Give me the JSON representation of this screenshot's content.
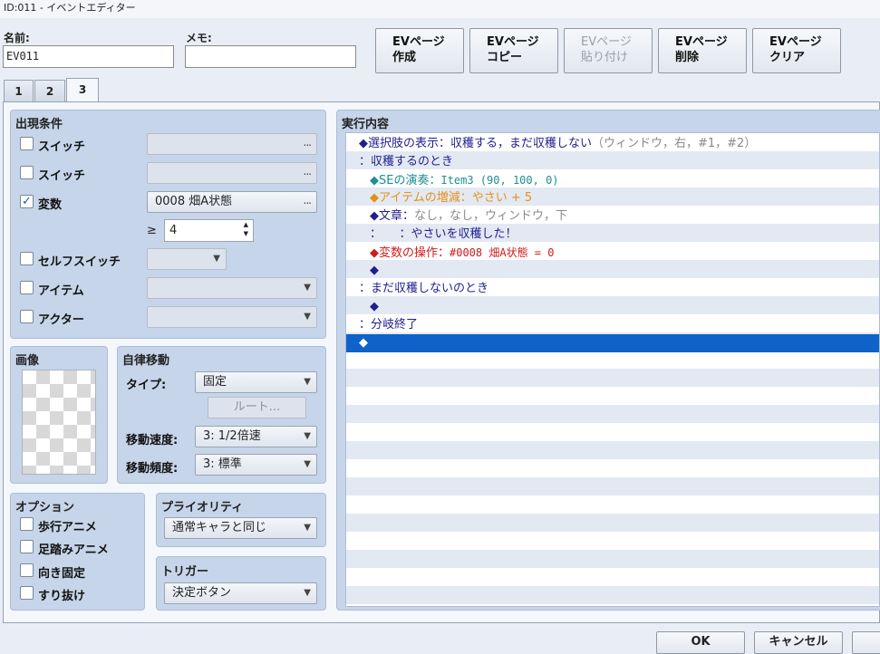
{
  "window": {
    "title": "ID:011 - イベントエディター"
  },
  "name": {
    "label": "名前:",
    "value": "EV011"
  },
  "memo": {
    "label": "メモ:",
    "value": ""
  },
  "page_buttons": [
    {
      "line1": "EVページ",
      "line2": "作成",
      "enabled": true
    },
    {
      "line1": "EVページ",
      "line2": "コピー",
      "enabled": true
    },
    {
      "line1": "EVページ",
      "line2": "貼り付け",
      "enabled": false
    },
    {
      "line1": "EVページ",
      "line2": "削除",
      "enabled": true
    },
    {
      "line1": "EVページ",
      "line2": "クリア",
      "enabled": true
    }
  ],
  "tabs": [
    "1",
    "2",
    "3"
  ],
  "active_tab": "3",
  "conditions": {
    "title": "出現条件",
    "switch1": {
      "label": "スイッチ",
      "checked": false,
      "value": "",
      "button": "..."
    },
    "switch2": {
      "label": "スイッチ",
      "checked": false,
      "value": "",
      "button": "..."
    },
    "variable": {
      "label": "変数",
      "checked": true,
      "value": "0008 畑A状態",
      "button": "...",
      "op": "≥",
      "amount": "4"
    },
    "self_switch": {
      "label": "セルフスイッチ",
      "checked": false,
      "value": ""
    },
    "item": {
      "label": "アイテム",
      "checked": false,
      "value": ""
    },
    "actor": {
      "label": "アクター",
      "checked": false,
      "value": ""
    },
    "check_mark": "✓"
  },
  "image": {
    "title": "画像"
  },
  "autonomous": {
    "title": "自律移動",
    "type_label": "タイプ:",
    "type_value": "固定",
    "route_button": "ルート...",
    "speed_label": "移動速度:",
    "speed_value": "3: 1/2倍速",
    "freq_label": "移動頻度:",
    "freq_value": "3: 標準"
  },
  "options": {
    "title": "オプション",
    "items": [
      {
        "label": "歩行アニメ",
        "checked": false
      },
      {
        "label": "足踏みアニメ",
        "checked": false
      },
      {
        "label": "向き固定",
        "checked": false
      },
      {
        "label": "すり抜け",
        "checked": false
      }
    ]
  },
  "priority": {
    "title": "プライオリティ",
    "value": "通常キャラと同じ"
  },
  "trigger": {
    "title": "トリガー",
    "value": "決定ボタン"
  },
  "contents": {
    "title": "実行内容",
    "rows": [
      {
        "main": "◆選択肢の表示：収穫する，まだ収穫しない",
        "extra": "（ウィンドウ，右，#1，#2）",
        "color": "#1f1f8f"
      },
      {
        "main": "：収穫するのとき",
        "extra": "",
        "color": "#1f1f8f"
      },
      {
        "main": "◆SEの演奏：",
        "extra": "Item3 (90, 100, 0)",
        "color": "#1f8f8f"
      },
      {
        "main": "◆アイテムの増減：やさい + 5",
        "extra": "",
        "color": "#e59018"
      },
      {
        "main": "◆文章：",
        "extra": "なし，なし，ウィンドウ，下",
        "color": "#1f1f8f"
      },
      {
        "main": "：　　：やさいを収穫した！",
        "extra": "",
        "color": "#1f1f8f"
      },
      {
        "main": "◆変数の操作：",
        "extra": "#0008 畑A状態 = 0",
        "color": "#d01a1a"
      },
      {
        "main": "◆",
        "extra": "",
        "color": "#1f1f8f"
      },
      {
        "main": "：まだ収穫しないのとき",
        "extra": "",
        "color": "#1f1f8f"
      },
      {
        "main": "◆",
        "extra": "",
        "color": "#1f1f8f"
      },
      {
        "main": "：分岐終了",
        "extra": "",
        "color": "#1f1f8f"
      },
      {
        "main": "◆",
        "extra": "",
        "color": "#ffffff",
        "selected": true
      }
    ]
  },
  "footer": {
    "ok": "OK",
    "cancel": "キャンセル"
  },
  "icons": {
    "arrow": "▼",
    "spin_up": "▲",
    "spin_down": "▼"
  }
}
